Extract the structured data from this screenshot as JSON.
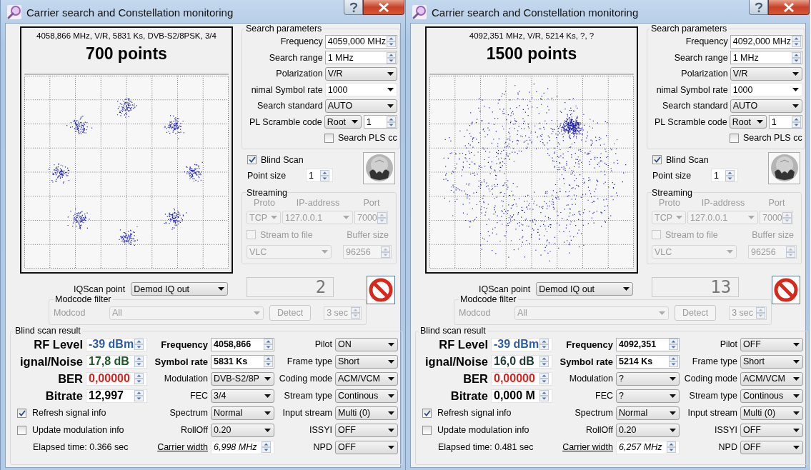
{
  "windows": [
    {
      "title": "Carrier search and Constellation monitoring",
      "plot": {
        "info": "4058,866 MHz, V/R, 5831 Ks, DVB-S2/8PSK, 3/4",
        "points": "700 points",
        "kind": "clusters"
      },
      "search_parameters": {
        "title": "Search parameters",
        "rows": [
          {
            "label": "Frequency",
            "kind": "spin",
            "value": "4059,000 MHz"
          },
          {
            "label": "Search range",
            "kind": "spin",
            "value": "1 MHz"
          },
          {
            "label": "Polarization",
            "kind": "select",
            "value": "V/R"
          },
          {
            "label": "nimal Symbol rate",
            "kind": "combo",
            "value": "1000"
          },
          {
            "label": "Search standard",
            "kind": "select",
            "value": "AUTO"
          },
          {
            "label": "PL Scramble code",
            "kind": "pair",
            "value": "Root",
            "value_2": "1"
          }
        ],
        "pls_search": {
          "label": "Search PLS cc",
          "checked": false
        }
      },
      "blind_scan": {
        "label": "Blind Scan",
        "checked": true
      },
      "point_size": {
        "label": "Point size",
        "value": "1"
      },
      "streaming": {
        "title": "Streaming",
        "disabled": true,
        "headers": [
          "Proto",
          "IP-address",
          "Port"
        ],
        "proto": "TCP",
        "ip": "127.0.0.1",
        "port": "7000",
        "stream_to_file": {
          "label": "Stream to file",
          "checked": false
        },
        "buffer_label": "Buffer size",
        "player": "VLC",
        "buffer": "96256"
      },
      "iq_scan": {
        "label": "IQScan point",
        "value": "Demod IQ out"
      },
      "counter": "2",
      "modcode_filter": {
        "title": "Modcode filter",
        "disabled": true,
        "label": "Modcod",
        "value": "All",
        "button": "Detect",
        "time": "3 sec"
      },
      "result": {
        "title": "Blind scan result",
        "metrics": [
          {
            "label": "RF Level",
            "value": "-39 dBm",
            "color": "#2a5cae"
          },
          {
            "label": "ignal/Noise",
            "value": "17,8 dB",
            "color": "#1c5a2a"
          },
          {
            "label": "BER",
            "value": "0,00000",
            "color": "#e0201a"
          },
          {
            "label": "Bitrate",
            "value": "12,997",
            "color": "#000000"
          }
        ],
        "checks": [
          {
            "label": "Refresh signal info",
            "checked": true
          },
          {
            "label": "Update modulation info",
            "checked": false
          }
        ],
        "elapsed": "Elapsed time: 0.366 sec",
        "fields": [
          {
            "label": "Frequency",
            "kind": "key",
            "value": "4058,866"
          },
          {
            "label": "Symbol rate",
            "kind": "key",
            "value": "5831 Ks"
          },
          {
            "label": "Modulation",
            "kind": "select",
            "value": "DVB-S2/8P"
          },
          {
            "label": "FEC",
            "kind": "select",
            "value": "3/4"
          },
          {
            "label": "Spectrum",
            "kind": "select",
            "value": "Normal"
          },
          {
            "label": "RollOff",
            "kind": "select",
            "value": "0.20"
          },
          {
            "label": "Carrier width",
            "kind": "measure",
            "value": "6,998 MHz"
          }
        ],
        "options": [
          {
            "label": "Pilot",
            "value": "ON"
          },
          {
            "label": "Frame type",
            "value": "Short"
          },
          {
            "label": "Coding mode",
            "value": "ACM/VCM"
          },
          {
            "label": "Stream type",
            "value": "Continous"
          },
          {
            "label": "Input stream",
            "value": "Multi (0)"
          },
          {
            "label": "ISSYI",
            "value": "OFF"
          },
          {
            "label": "NPD",
            "value": "OFF"
          }
        ]
      }
    },
    {
      "title": "Carrier search and Constellation monitoring",
      "plot": {
        "info": "4092,351 MHz, V/R, 5214 Ks, ?, ?",
        "points": "1500 points",
        "kind": "scattered"
      },
      "search_parameters": {
        "title": "Search parameters",
        "rows": [
          {
            "label": "Frequency",
            "kind": "spin",
            "value": "4092,000 MHz"
          },
          {
            "label": "Search range",
            "kind": "spin",
            "value": "1 MHz"
          },
          {
            "label": "Polarization",
            "kind": "select",
            "value": "V/R"
          },
          {
            "label": "nimal Symbol rate",
            "kind": "combo",
            "value": "1000"
          },
          {
            "label": "Search standard",
            "kind": "select",
            "value": "AUTO"
          },
          {
            "label": "PL Scramble code",
            "kind": "pair",
            "value": "Root",
            "value_2": "1"
          }
        ],
        "pls_search": {
          "label": "Search PLS cc",
          "checked": false
        }
      },
      "blind_scan": {
        "label": "Blind Scan",
        "checked": true
      },
      "point_size": {
        "label": "Point size",
        "value": "1"
      },
      "streaming": {
        "title": "Streaming",
        "disabled": true,
        "headers": [
          "Proto",
          "IP-address",
          "Port"
        ],
        "proto": "TCP",
        "ip": "127.0.0.1",
        "port": "7000",
        "stream_to_file": {
          "label": "Stream to file",
          "checked": false
        },
        "buffer_label": "Buffer size",
        "player": "VLC",
        "buffer": "96256"
      },
      "iq_scan": {
        "label": "IQScan point",
        "value": "Demod IQ out"
      },
      "counter": "13",
      "modcode_filter": {
        "title": "Modcode filter",
        "disabled": true,
        "label": "Modcod",
        "value": "All",
        "button": "Detect",
        "time": "3 sec"
      },
      "result": {
        "title": "Blind scan result",
        "metrics": [
          {
            "label": "RF Level",
            "value": "-39 dBm",
            "color": "#2a5cae"
          },
          {
            "label": "ignal/Noise",
            "value": "16,0 dB",
            "color": "#1f3a36"
          },
          {
            "label": "BER",
            "value": "0,00000",
            "color": "#e0201a"
          },
          {
            "label": "Bitrate",
            "value": "0,000 M",
            "color": "#000000"
          }
        ],
        "checks": [
          {
            "label": "Refresh signal info",
            "checked": true
          },
          {
            "label": "Update modulation info",
            "checked": false
          }
        ],
        "elapsed": "Elapsed time: 0.481 sec",
        "fields": [
          {
            "label": "Frequency",
            "kind": "key",
            "value": "4092,351"
          },
          {
            "label": "Symbol rate",
            "kind": "key",
            "value": "5214 Ks"
          },
          {
            "label": "Modulation",
            "kind": "select",
            "value": "?"
          },
          {
            "label": "FEC",
            "kind": "select",
            "value": "?"
          },
          {
            "label": "Spectrum",
            "kind": "select",
            "value": "Normal"
          },
          {
            "label": "RollOff",
            "kind": "select",
            "value": "0.20"
          },
          {
            "label": "Carrier width",
            "kind": "measure",
            "value": "6,257 MHz"
          }
        ],
        "options": [
          {
            "label": "Pilot",
            "value": "OFF"
          },
          {
            "label": "Frame type",
            "value": "Short"
          },
          {
            "label": "Coding mode",
            "value": "ACM/VCM"
          },
          {
            "label": "Stream type",
            "value": "Continous"
          },
          {
            "label": "Input stream",
            "value": "Multi (0)"
          },
          {
            "label": "ISSYI",
            "value": "OFF"
          },
          {
            "label": "NPD",
            "value": "OFF"
          }
        ]
      }
    }
  ]
}
